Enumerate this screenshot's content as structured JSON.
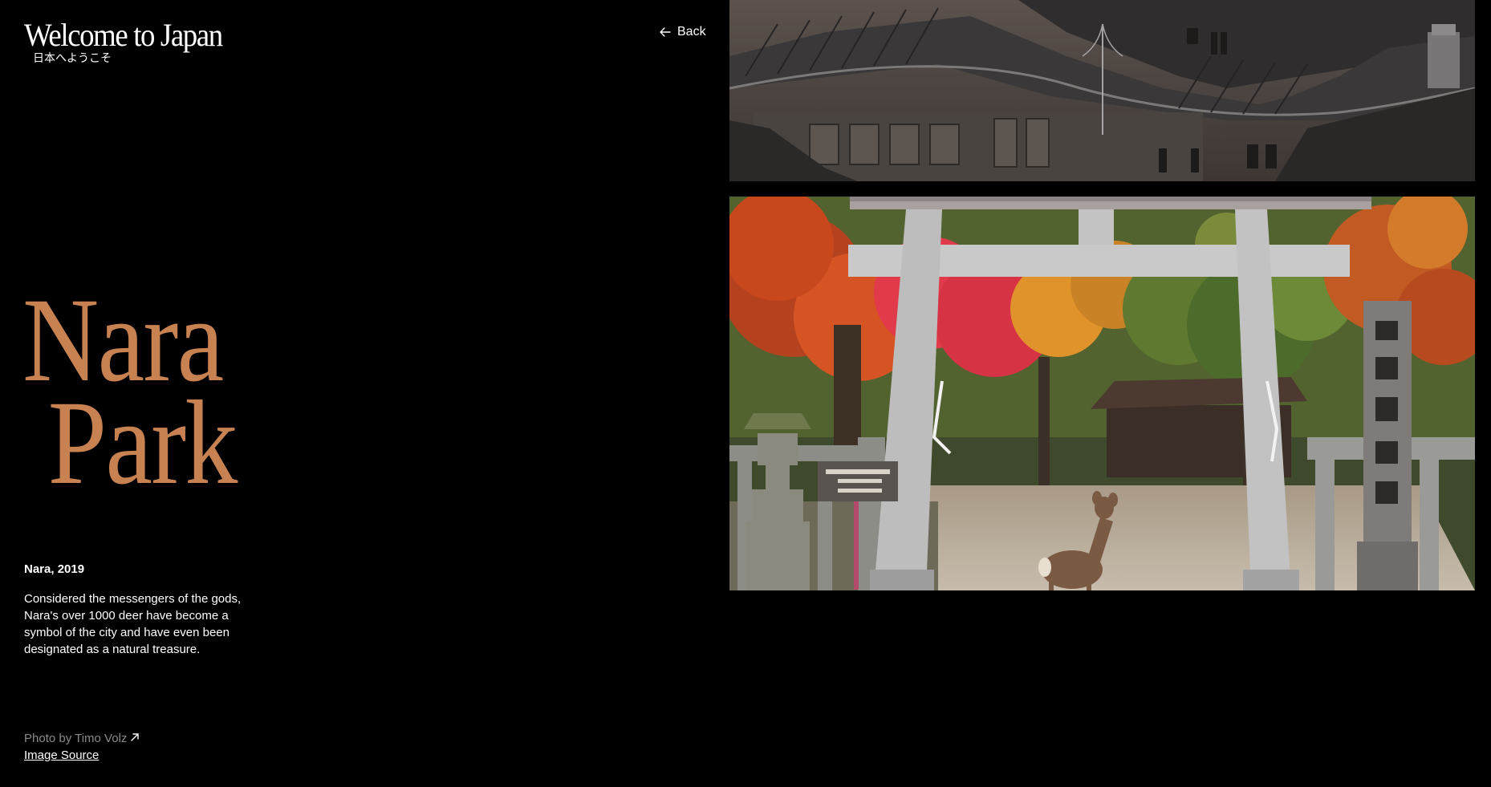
{
  "header": {
    "title": "Welcome to Japan",
    "subtitle": "日本へようこそ",
    "back_label": "Back",
    "back_icon": "arrow-left-icon"
  },
  "hero": {
    "title_line1": "Nara",
    "title_line2": "Park",
    "title_color": "#c88252"
  },
  "caption": {
    "heading": "Nara, 2019",
    "body": "Considered the messengers of the gods, Nara's over 1000 deer have become a symbol of the city and have even been designated as a natural treasure."
  },
  "credits": {
    "photo_by": "Photo by Timo Volz",
    "external_icon": "arrow-up-right-icon",
    "source_label": "Image Source"
  },
  "images": {
    "top": "japanese-castle-roof-photo",
    "main": "torii-gate-deer-autumn-photo"
  },
  "colors": {
    "background": "#000000",
    "text": "#ffffff",
    "muted": "#8a8a8a",
    "accent": "#c88252"
  }
}
